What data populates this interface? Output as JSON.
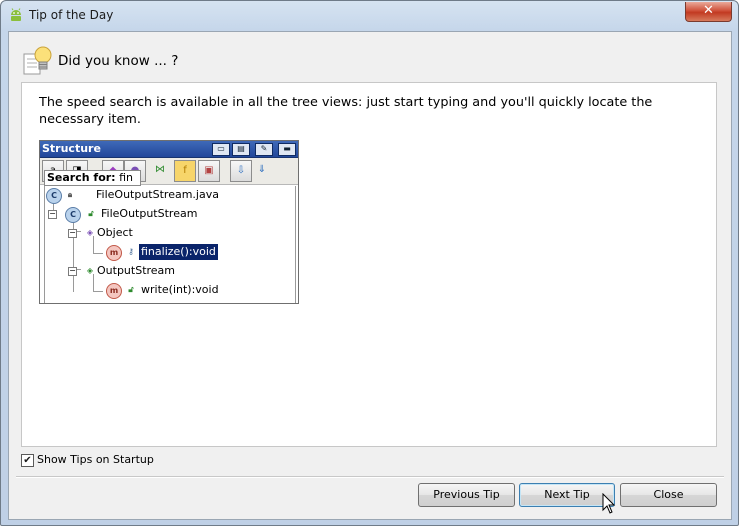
{
  "window": {
    "title": "Tip of the Day",
    "close_glyph": "✕"
  },
  "header": {
    "title": "Did you know ... ?",
    "icon": "lightbulb-icon"
  },
  "tip": {
    "text": "The speed search is available in all the tree views: just start typing and you'll quickly locate the necessary item."
  },
  "illustration": {
    "panel_title": "Structure",
    "search_label": "Search for:",
    "search_value": "fin",
    "tree": [
      {
        "label": "FileOutputStream.java"
      },
      {
        "label": "FileOutputStream"
      },
      {
        "label": "Object"
      },
      {
        "label": "finalize():void"
      },
      {
        "label": "OutputStream"
      },
      {
        "label": "write(int):void"
      }
    ]
  },
  "options": {
    "show_tips_label": "Show Tips on Startup",
    "show_tips_checked": true
  },
  "buttons": {
    "previous": "Previous Tip",
    "next": "Next Tip",
    "close": "Close"
  },
  "colors": {
    "selection": "#0a246a",
    "panel_header": "#21479a",
    "window_frame": "#c5d6ea"
  }
}
